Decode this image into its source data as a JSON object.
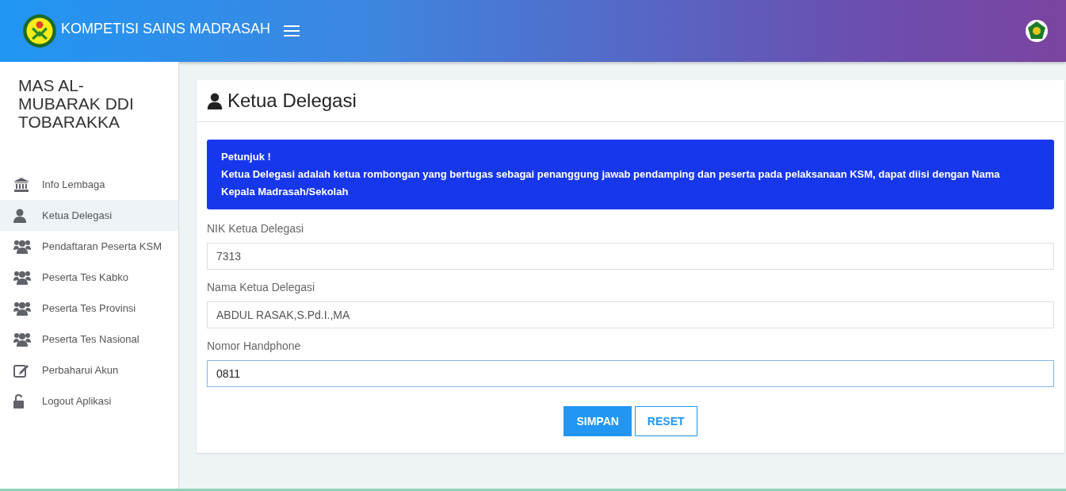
{
  "header": {
    "title": "KOMPETISI SAINS MADRASAH"
  },
  "sidebar": {
    "institution": "MAS AL-MUBARAK DDI TOBARAKKA",
    "items": [
      {
        "label": "Info Lembaga",
        "kind": "bank",
        "selected": false
      },
      {
        "label": "Ketua Delegasi",
        "kind": "user",
        "selected": true
      },
      {
        "label": "Pendaftaran Peserta KSM",
        "kind": "users",
        "selected": false
      },
      {
        "label": "Peserta Tes Kabko",
        "kind": "users",
        "selected": false
      },
      {
        "label": "Peserta Tes Provinsi",
        "kind": "users",
        "selected": false
      },
      {
        "label": "Peserta Tes Nasional",
        "kind": "users",
        "selected": false
      },
      {
        "label": "Perbaharui Akun",
        "kind": "edit",
        "selected": false
      },
      {
        "label": "Logout Aplikasi",
        "kind": "unlock",
        "selected": false
      }
    ]
  },
  "panel": {
    "title": "Ketua Delegasi",
    "notice": {
      "heading": "Petunjuk !",
      "text": "Ketua Delegasi adalah ketua rombongan yang bertugas sebagai penanggung jawab pendamping dan peserta pada pelaksanaan KSM, dapat diisi dengan Nama Kepala Madrasah/Sekolah"
    },
    "fields": [
      {
        "label": "NIK Ketua Delegasi",
        "value": "7313",
        "focused": false
      },
      {
        "label": "Nama Ketua Delegasi",
        "value": "ABDUL RASAK,S.Pd.I.,MA",
        "focused": false
      },
      {
        "label": "Nomor Handphone",
        "value": "0811",
        "focused": true
      }
    ],
    "buttons": [
      {
        "label": "SIMPAN",
        "kind": "primary"
      },
      {
        "label": "RESET",
        "kind": "outline"
      }
    ]
  }
}
